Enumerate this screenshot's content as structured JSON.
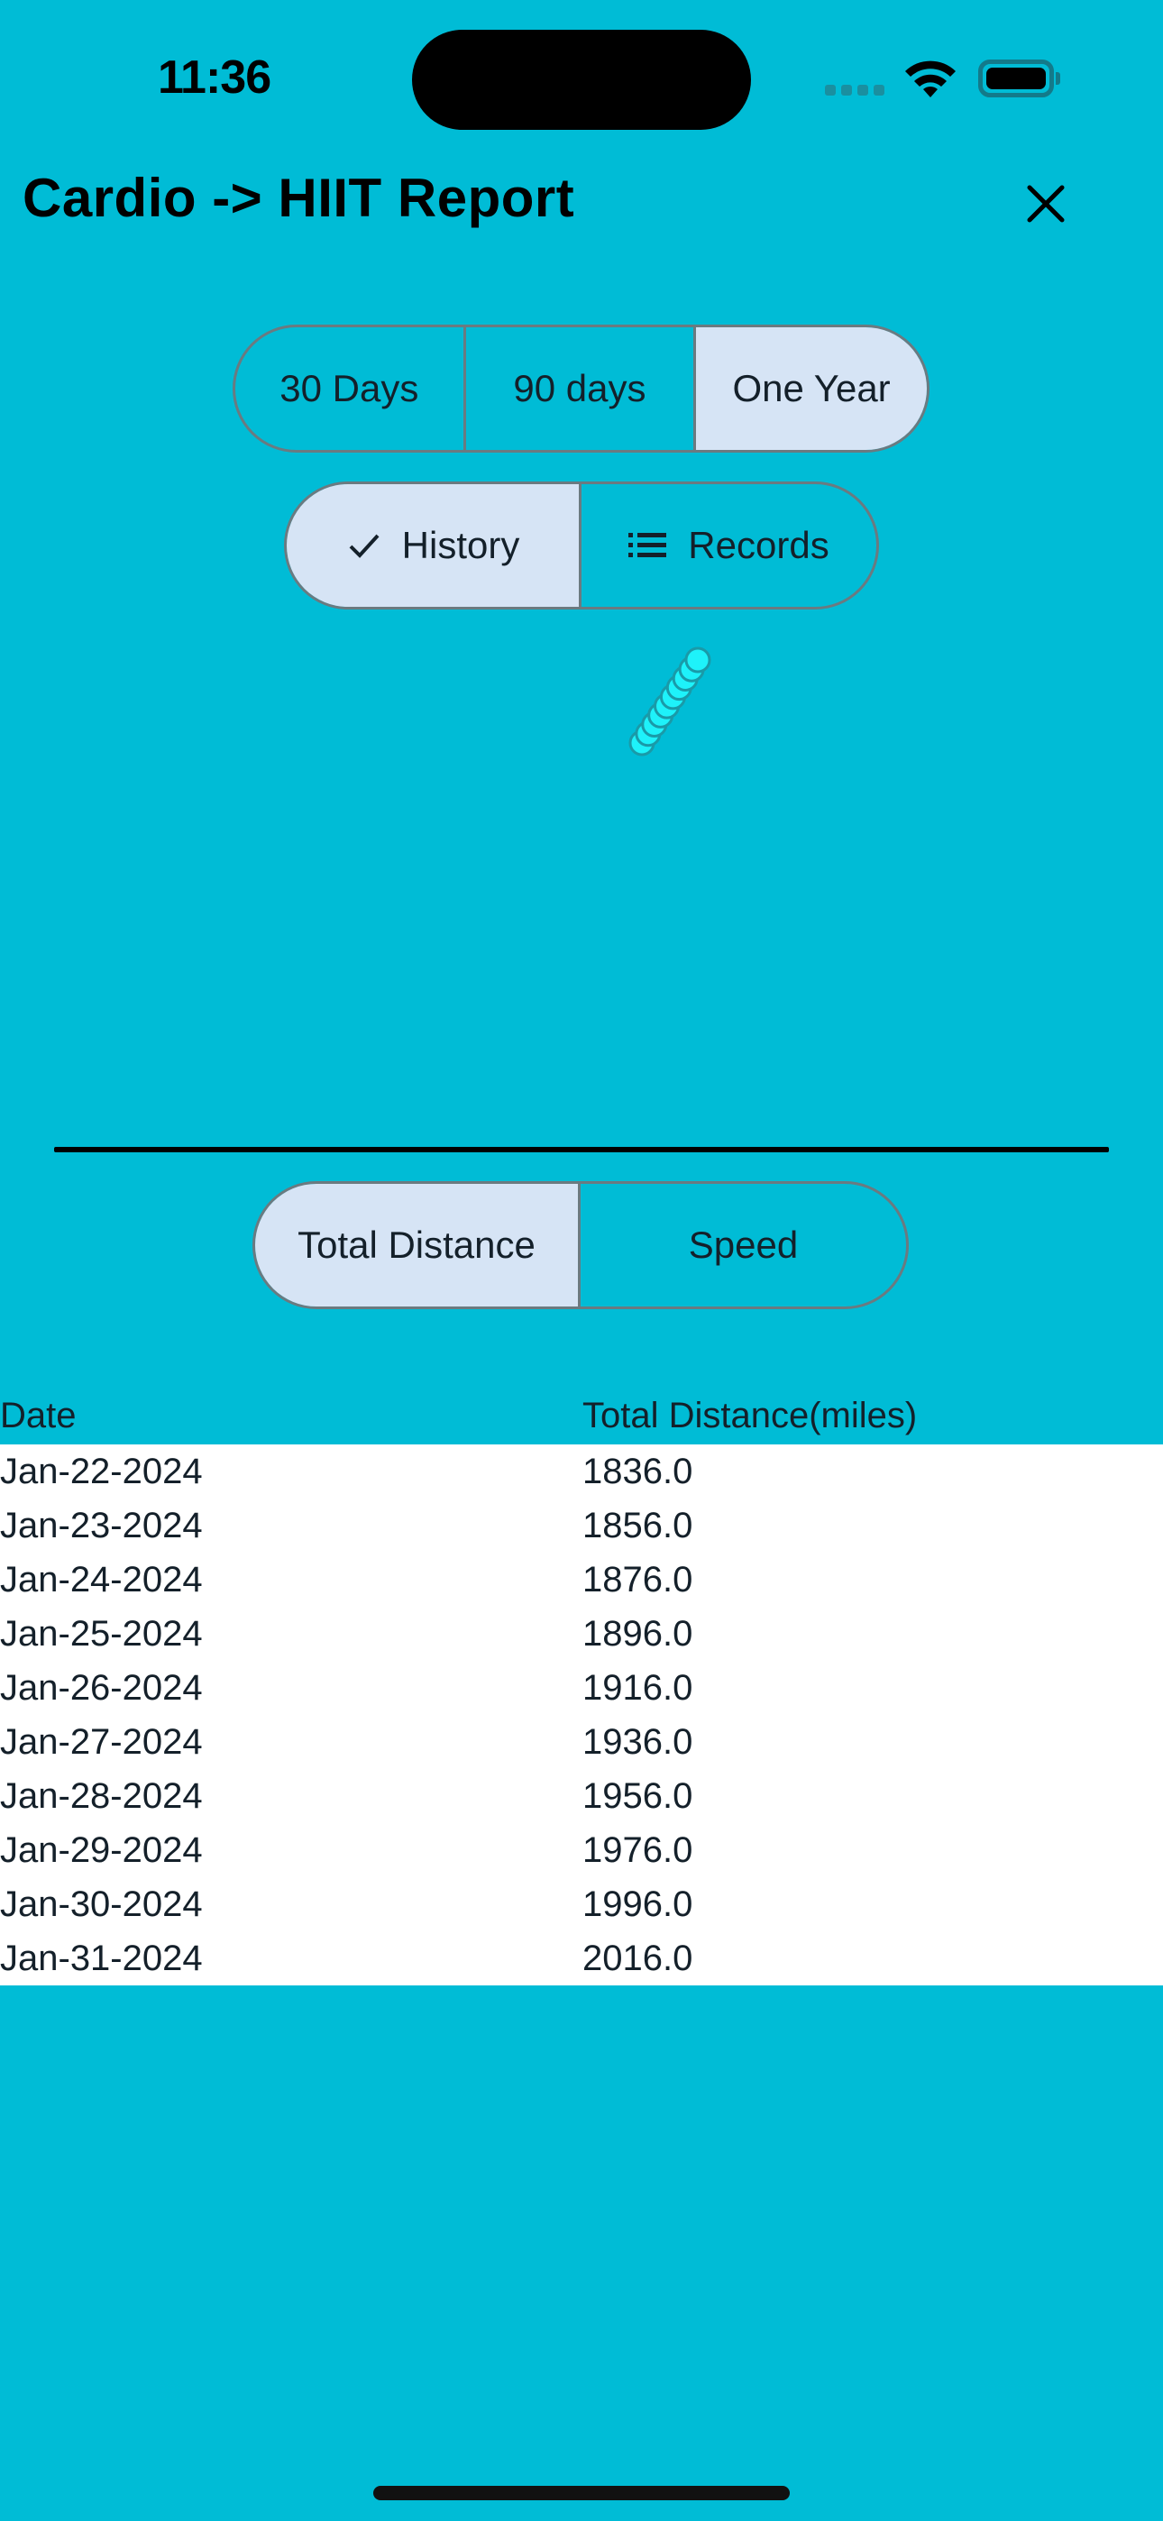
{
  "status_bar": {
    "time": "11:36",
    "icons": [
      "cellular-signal-icon",
      "wifi-icon",
      "battery-icon"
    ]
  },
  "header": {
    "title": "Cardio -> HIIT Report",
    "close_icon": "close-icon"
  },
  "range_selector": {
    "options": [
      {
        "label": "30 Days",
        "selected": false
      },
      {
        "label": "90 days",
        "selected": false
      },
      {
        "label": "One Year",
        "selected": true
      }
    ]
  },
  "view_selector": {
    "options": [
      {
        "label": "History",
        "icon": "checkmark-icon",
        "selected": true
      },
      {
        "label": "Records",
        "icon": "list-icon",
        "selected": false
      }
    ]
  },
  "metric_selector": {
    "options": [
      {
        "label": "Total Distance",
        "selected": true
      },
      {
        "label": "Speed",
        "selected": false
      }
    ]
  },
  "chart_data": {
    "type": "scatter",
    "title": "",
    "xlabel": "",
    "ylabel": "",
    "x": [
      "Jan-22-2024",
      "Jan-23-2024",
      "Jan-24-2024",
      "Jan-25-2024",
      "Jan-26-2024",
      "Jan-27-2024",
      "Jan-28-2024",
      "Jan-29-2024",
      "Jan-30-2024",
      "Jan-31-2024"
    ],
    "series": [
      {
        "name": "Total Distance",
        "values": [
          1836.0,
          1856.0,
          1876.0,
          1896.0,
          1916.0,
          1936.0,
          1956.0,
          1976.0,
          1996.0,
          2016.0
        ]
      }
    ],
    "colors": {
      "marker_fill": "#1ef2fa",
      "marker_stroke": "#1a9aa8"
    },
    "grid": false
  },
  "table": {
    "headers": [
      "Date",
      "Total Distance(miles)"
    ],
    "rows": [
      [
        "Jan-22-2024",
        "1836.0"
      ],
      [
        "Jan-23-2024",
        "1856.0"
      ],
      [
        "Jan-24-2024",
        "1876.0"
      ],
      [
        "Jan-25-2024",
        "1896.0"
      ],
      [
        "Jan-26-2024",
        "1916.0"
      ],
      [
        "Jan-27-2024",
        "1936.0"
      ],
      [
        "Jan-28-2024",
        "1956.0"
      ],
      [
        "Jan-29-2024",
        "1976.0"
      ],
      [
        "Jan-30-2024",
        "1996.0"
      ],
      [
        "Jan-31-2024",
        "2016.0"
      ]
    ]
  },
  "colors": {
    "background": "#00bcd6",
    "selected_segment": "#d6e4f5",
    "table_background": "#ffffff"
  }
}
